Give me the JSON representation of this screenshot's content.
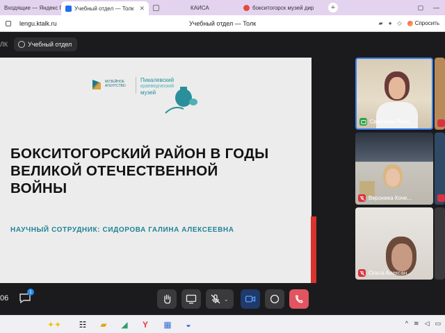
{
  "browser": {
    "tabs": [
      {
        "label": "Входящие — Яндекс Почта",
        "active": false
      },
      {
        "label": "Учебный отдел — Толк",
        "active": true
      },
      {
        "label": "",
        "active": false
      },
      {
        "label": "КАИСА",
        "active": false
      },
      {
        "label": "бокситогорск музей дир",
        "active": false
      }
    ],
    "url": "lengu.ktalk.ru",
    "page_title": "Учебный отдел — Толк",
    "ask_label": "Спросить"
  },
  "app": {
    "brand": "ЛК",
    "room_name": "Учебный отдел",
    "slide": {
      "logo_org": "МУЗЕЙНОЕ АГЕНТСТВО",
      "logo_museum": "Пикалевский",
      "logo_museum_sub": "краеведческий",
      "logo_museum_word": "музей",
      "title": "БОКСИТОГОРСКИЙ РАЙОН В ГОДЫ ВЕЛИКОЙ ОТЕЧЕСТВЕННОЙ ВОЙНЫ",
      "author": "НАУЧНЫЙ СОТРУДНИК:  СИДОРОВА ГАЛИНА АЛЕКСЕЕВНА"
    },
    "participants": [
      {
        "name": "Светлана Рома...",
        "mic": "on"
      },
      {
        "name": "Вероника Коче...",
        "mic": "off"
      },
      {
        "name": "Ольга Алексан...",
        "mic": "off"
      }
    ],
    "controls": {
      "timer": "06",
      "chat_badge": "1"
    }
  },
  "colors": {
    "accent": "#1e8496",
    "hangup": "#e05560",
    "camera_active": "#1f6feb"
  }
}
